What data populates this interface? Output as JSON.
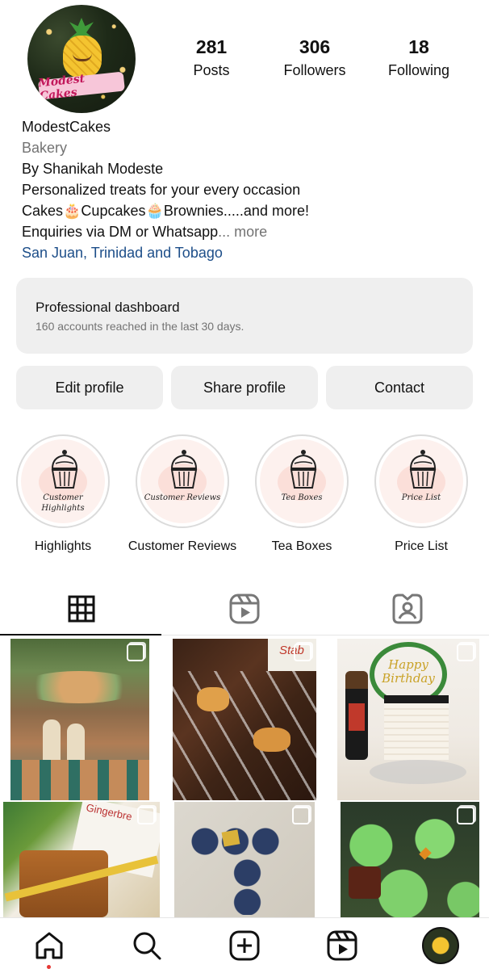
{
  "profile": {
    "avatar_text": "Modest Cakes",
    "stats": [
      {
        "value": "281",
        "label": "Posts"
      },
      {
        "value": "306",
        "label": "Followers"
      },
      {
        "value": "18",
        "label": "Following"
      }
    ],
    "name": "ModestCakes",
    "category": "Bakery",
    "bio_lines": [
      "By Shanikah Modeste",
      "Personalized treats for your every occasion",
      "Cakes🎂Cupcakes🧁Brownies.....and more!",
      "Enquiries via DM or Whatsapp"
    ],
    "more_label": "... more",
    "location": "San Juan, Trinidad and Tobago"
  },
  "dashboard": {
    "title": "Professional dashboard",
    "subtitle": "160 accounts reached in the last 30 days."
  },
  "buttons": {
    "edit": "Edit profile",
    "share": "Share profile",
    "contact": "Contact"
  },
  "highlights": [
    {
      "caption": "Customer Highlights",
      "label": "Highlights"
    },
    {
      "caption": "Customer Reviews",
      "label": "Customer Reviews"
    },
    {
      "caption": "Tea Boxes",
      "label": "Tea Boxes"
    },
    {
      "caption": "Price List",
      "label": "Price List"
    }
  ],
  "tabs": [
    {
      "icon": "grid-icon",
      "active": true
    },
    {
      "icon": "reels-icon",
      "active": false
    },
    {
      "icon": "tagged-icon",
      "active": false
    }
  ],
  "posts": [
    {
      "subject": "favor boxes table",
      "multi": true
    },
    {
      "subject": "brownies",
      "multi": true
    },
    {
      "subject": "happy birthday cake",
      "multi": true
    },
    {
      "subject": "gingerbread loaf",
      "multi": true
    },
    {
      "subject": "letter cupcake cake",
      "multi": true
    },
    {
      "subject": "green cupcakes",
      "multi": true
    }
  ],
  "post_overlay_text": {
    "birthday_topper": "Happy Birthday",
    "gingerbread_tag": "Gingerbre",
    "brownie_box_text": "Stab"
  },
  "bottom_nav": [
    "home-icon",
    "search-icon",
    "create-icon",
    "reels-icon",
    "profile-avatar"
  ],
  "colors": {
    "link": "#1d4e89",
    "secondary_text": "#737373",
    "button_bg": "#efefef"
  }
}
